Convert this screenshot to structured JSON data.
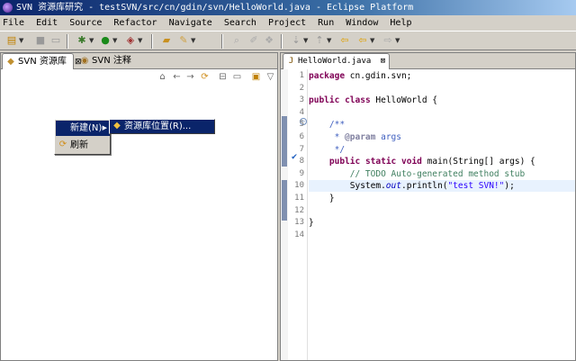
{
  "window": {
    "title": "SVN 资源库研究 - testSVN/src/cn/gdin/svn/HelloWorld.java - Eclipse Platform"
  },
  "menubar": {
    "items": [
      "File",
      "Edit",
      "Source",
      "Refactor",
      "Navigate",
      "Search",
      "Project",
      "Run",
      "Window",
      "Help"
    ]
  },
  "toolbar": {
    "icons": [
      "new-icon",
      "save-icon",
      "print-icon",
      "debug-icon",
      "run-icon",
      "external-tools-icon",
      "open-folder-icon",
      "open-type-icon",
      "next-annotation-icon",
      "prev-annotation-icon",
      "back-icon",
      "forward-icon"
    ]
  },
  "left_view": {
    "tabs": [
      {
        "label": "SVN 资源库",
        "icon": "svn-repository-icon",
        "close": "⊠",
        "active": true
      },
      {
        "label": "SVN 注释",
        "icon": "svn-annotate-icon",
        "active": false
      }
    ]
  },
  "context_menu": {
    "items": [
      {
        "label": "新建(N)",
        "has_submenu": true,
        "selected": true
      },
      {
        "label": "刷新",
        "icon": "refresh-icon"
      }
    ],
    "submenu": {
      "label": "资源库位置(R)...",
      "icon": "repository-location-icon"
    }
  },
  "editor": {
    "tab": {
      "label": "HelloWorld.java",
      "icon": "java-file-icon",
      "close": "⊠"
    },
    "current_line": 10,
    "line_numbers": [
      "1",
      "2",
      "3",
      "4",
      "5",
      "6",
      "7",
      "8",
      "9",
      "10",
      "11",
      "12",
      "13",
      "14"
    ],
    "lines": [
      [
        {
          "t": "kw",
          "v": "package"
        },
        {
          "t": "",
          "v": " cn.gdin.svn;"
        }
      ],
      [],
      [
        {
          "t": "kw",
          "v": "public"
        },
        {
          "t": "",
          "v": " "
        },
        {
          "t": "kw",
          "v": "class"
        },
        {
          "t": "",
          "v": " HelloWorld {"
        }
      ],
      [],
      [
        {
          "t": "",
          "v": "    "
        },
        {
          "t": "cm",
          "v": "/**"
        }
      ],
      [
        {
          "t": "cm",
          "v": "     * "
        },
        {
          "t": "ann",
          "v": "@param"
        },
        {
          "t": "cm",
          "v": " args"
        }
      ],
      [
        {
          "t": "cm",
          "v": "     */"
        }
      ],
      [
        {
          "t": "",
          "v": "    "
        },
        {
          "t": "kw",
          "v": "public"
        },
        {
          "t": "",
          "v": " "
        },
        {
          "t": "kw",
          "v": "static"
        },
        {
          "t": "",
          "v": " "
        },
        {
          "t": "kw",
          "v": "void"
        },
        {
          "t": "",
          "v": " main(String[] args) {"
        }
      ],
      [
        {
          "t": "",
          "v": "        "
        },
        {
          "t": "todo",
          "v": "// TODO Auto-generated method stub"
        }
      ],
      [
        {
          "t": "",
          "v": "        System."
        },
        {
          "t": "fld",
          "v": "out"
        },
        {
          "t": "",
          "v": ".println("
        },
        {
          "t": "str",
          "v": "\"test SVN!\""
        },
        {
          "t": "",
          "v": ");"
        }
      ],
      [
        {
          "t": "",
          "v": "    }"
        }
      ],
      [],
      [
        {
          "t": "",
          "v": "}"
        }
      ],
      []
    ]
  }
}
